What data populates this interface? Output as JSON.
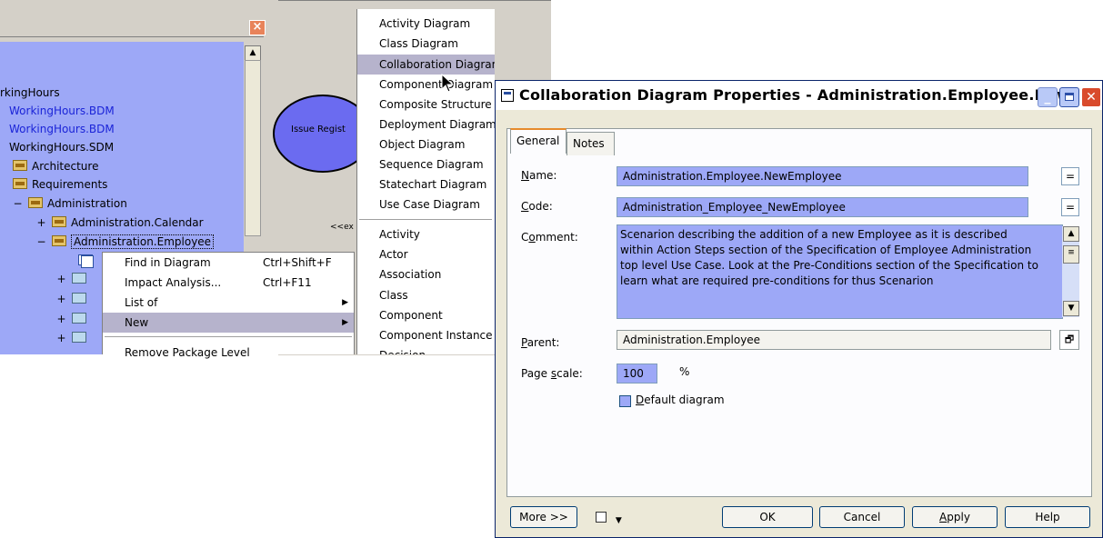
{
  "browser": {
    "tree_items": [
      {
        "label": "rkingHours",
        "blue": false
      },
      {
        "label": "WorkingHours.BDM",
        "blue": true
      },
      {
        "label": "WorkingHours.BDM",
        "blue": true
      },
      {
        "label": "WorkingHours.SDM",
        "blue": false
      },
      {
        "label": "Architecture"
      },
      {
        "label": "Requirements"
      },
      {
        "label": "Administration",
        "expander": "−"
      },
      {
        "label": "Administration.Calendar",
        "expander": "+"
      },
      {
        "label": "Administration.Employee",
        "expander": "−"
      }
    ],
    "subfolder_expanders": [
      "+",
      "+",
      "+",
      "+"
    ]
  },
  "canvas": {
    "ellipse_label": "Issue Regist",
    "ext_label": "<<ex"
  },
  "context_menu": {
    "items": [
      {
        "label": "Find in Diagram",
        "shortcut": "Ctrl+Shift+F"
      },
      {
        "label": "Impact Analysis...",
        "shortcut": "Ctrl+F11"
      },
      {
        "label": "List of",
        "arrow": "▶"
      },
      {
        "label": "New",
        "arrow": "▶"
      },
      {
        "label": "Remove Package Level"
      }
    ]
  },
  "submenu": {
    "diagrams": [
      "Activity Diagram",
      "Class Diagram",
      "Collaboration Diagram",
      "Component Diagram",
      "Composite Structure",
      "Deployment Diagram",
      "Object Diagram",
      "Sequence Diagram",
      "Statechart Diagram",
      "Use Case Diagram"
    ],
    "objects": [
      "Activity",
      "Actor",
      "Association",
      "Class",
      "Component",
      "Component Instance",
      "Decision"
    ]
  },
  "dialog": {
    "title": "Collaboration Diagram Properties - Administration.Employee.New...",
    "tabs": {
      "general": "General",
      "notes": "Notes"
    },
    "labels": {
      "name_u": "N",
      "name": "ame:",
      "code_u": "C",
      "code": "ode:",
      "comment_pre": "C",
      "comment_u": "o",
      "comment": "mment:",
      "parent_u": "P",
      "parent": "arent:",
      "scale": "Page ",
      "scale_u": "s",
      "scale_post": "cale:"
    },
    "name_value": "Administration.Employee.NewEmployee",
    "code_value": "Administration_Employee_NewEmployee",
    "comment_value": "Scenarion describing the addition of a new Employee as it is described within Action Steps section of the Specification of Employee Administration top level Use Case. Look at the Pre-Conditions section of the Specification to learn what are required pre-conditions for thus Scenarion",
    "parent_value": "Administration.Employee",
    "page_scale_value": "100",
    "percent": "%",
    "default_diagram_u": "D",
    "default_diagram": "efault diagram",
    "default_diagram_checked": false,
    "eq_symbol": "=",
    "buttons": {
      "more": "More >>",
      "ok": "OK",
      "cancel": "Cancel",
      "apply_u": "A",
      "apply": "pply",
      "help": "Help"
    }
  }
}
